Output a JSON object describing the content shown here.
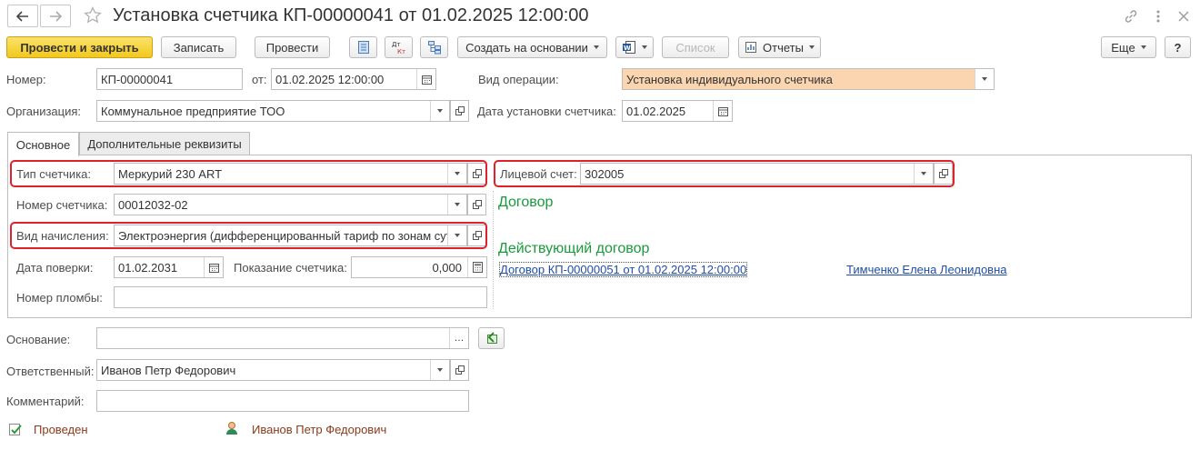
{
  "window": {
    "title": "Установка счетчика КП-00000041 от 01.02.2025 12:00:00"
  },
  "toolbar": {
    "post_close": "Провести и закрыть",
    "save": "Записать",
    "post": "Провести",
    "create_based": "Создать на основании",
    "list": "Список",
    "reports": "Отчеты",
    "more": "Еще",
    "help": "?"
  },
  "header": {
    "number_label": "Номер:",
    "number_value": "КП-00000041",
    "date_label": "от:",
    "date_value": "01.02.2025 12:00:00",
    "op_label": "Вид операции:",
    "op_value": "Установка индивидуального счетчика",
    "org_label": "Организация:",
    "org_value": "Коммунальное предприятие ТОО",
    "install_date_label": "Дата установки счетчика:",
    "install_date_value": "01.02.2025"
  },
  "tabs": [
    {
      "label": "Основное",
      "active": true
    },
    {
      "label": "Дополнительные реквизиты",
      "active": false
    }
  ],
  "main": {
    "meter_type_label": "Тип счетчика:",
    "meter_type_value": "Меркурий 230 ART",
    "meter_number_label": "Номер счетчика:",
    "meter_number_value": "00012032-02",
    "accrual_label": "Вид начисления:",
    "accrual_value": "Электроэнергия (дифференцированный тариф по зонам суток)",
    "verify_label": "Дата поверки:",
    "verify_value": "01.02.2031",
    "reading_label": "Показание счетчика:",
    "reading_value": "0,000",
    "seal_label": "Номер пломбы:",
    "seal_value": "",
    "account_label": "Лицевой счет:",
    "account_value": "302005",
    "contract_heading": "Договор",
    "active_contract_heading": "Действующий договор",
    "contract_link": "Договор КП-00000051 от 01.02.2025 12:00:00",
    "contract_person": "Тимченко Елена Леонидовна"
  },
  "footer": {
    "basis_label": "Основание:",
    "basis_value": "",
    "responsible_label": "Ответственный:",
    "responsible_value": "Иванов Петр Федорович",
    "comment_label": "Комментарий:",
    "comment_value": "",
    "status": "Проведен",
    "author": "Иванов Петр Федорович"
  },
  "colors": {
    "primary_button": "#f2c81c",
    "operation_field_bg": "#fbd5b0",
    "highlight_border": "#e0202a",
    "section_heading": "#1a9a3c",
    "link": "#1f4ea8"
  }
}
